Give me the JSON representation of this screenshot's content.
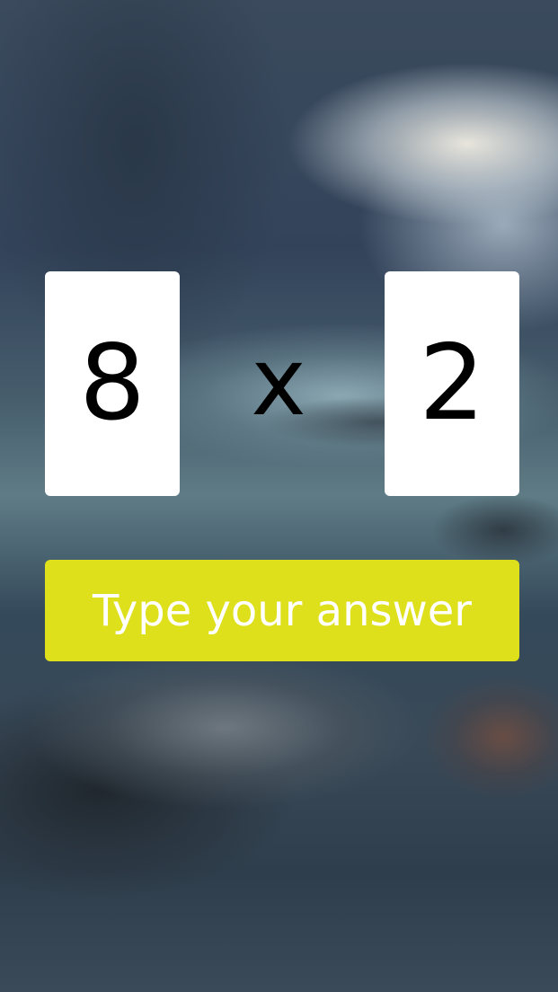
{
  "colors": {
    "card_background": "#ffffff",
    "digit_color": "#000000",
    "answer_button_background": "#dee01c",
    "answer_button_text": "#ffffff"
  },
  "background": {
    "description_icon": "blurred-mountain-river-photo"
  },
  "problem": {
    "left_operand": "8",
    "operator": "x",
    "right_operand": "2"
  },
  "answer_button": {
    "label": "Type your answer"
  }
}
